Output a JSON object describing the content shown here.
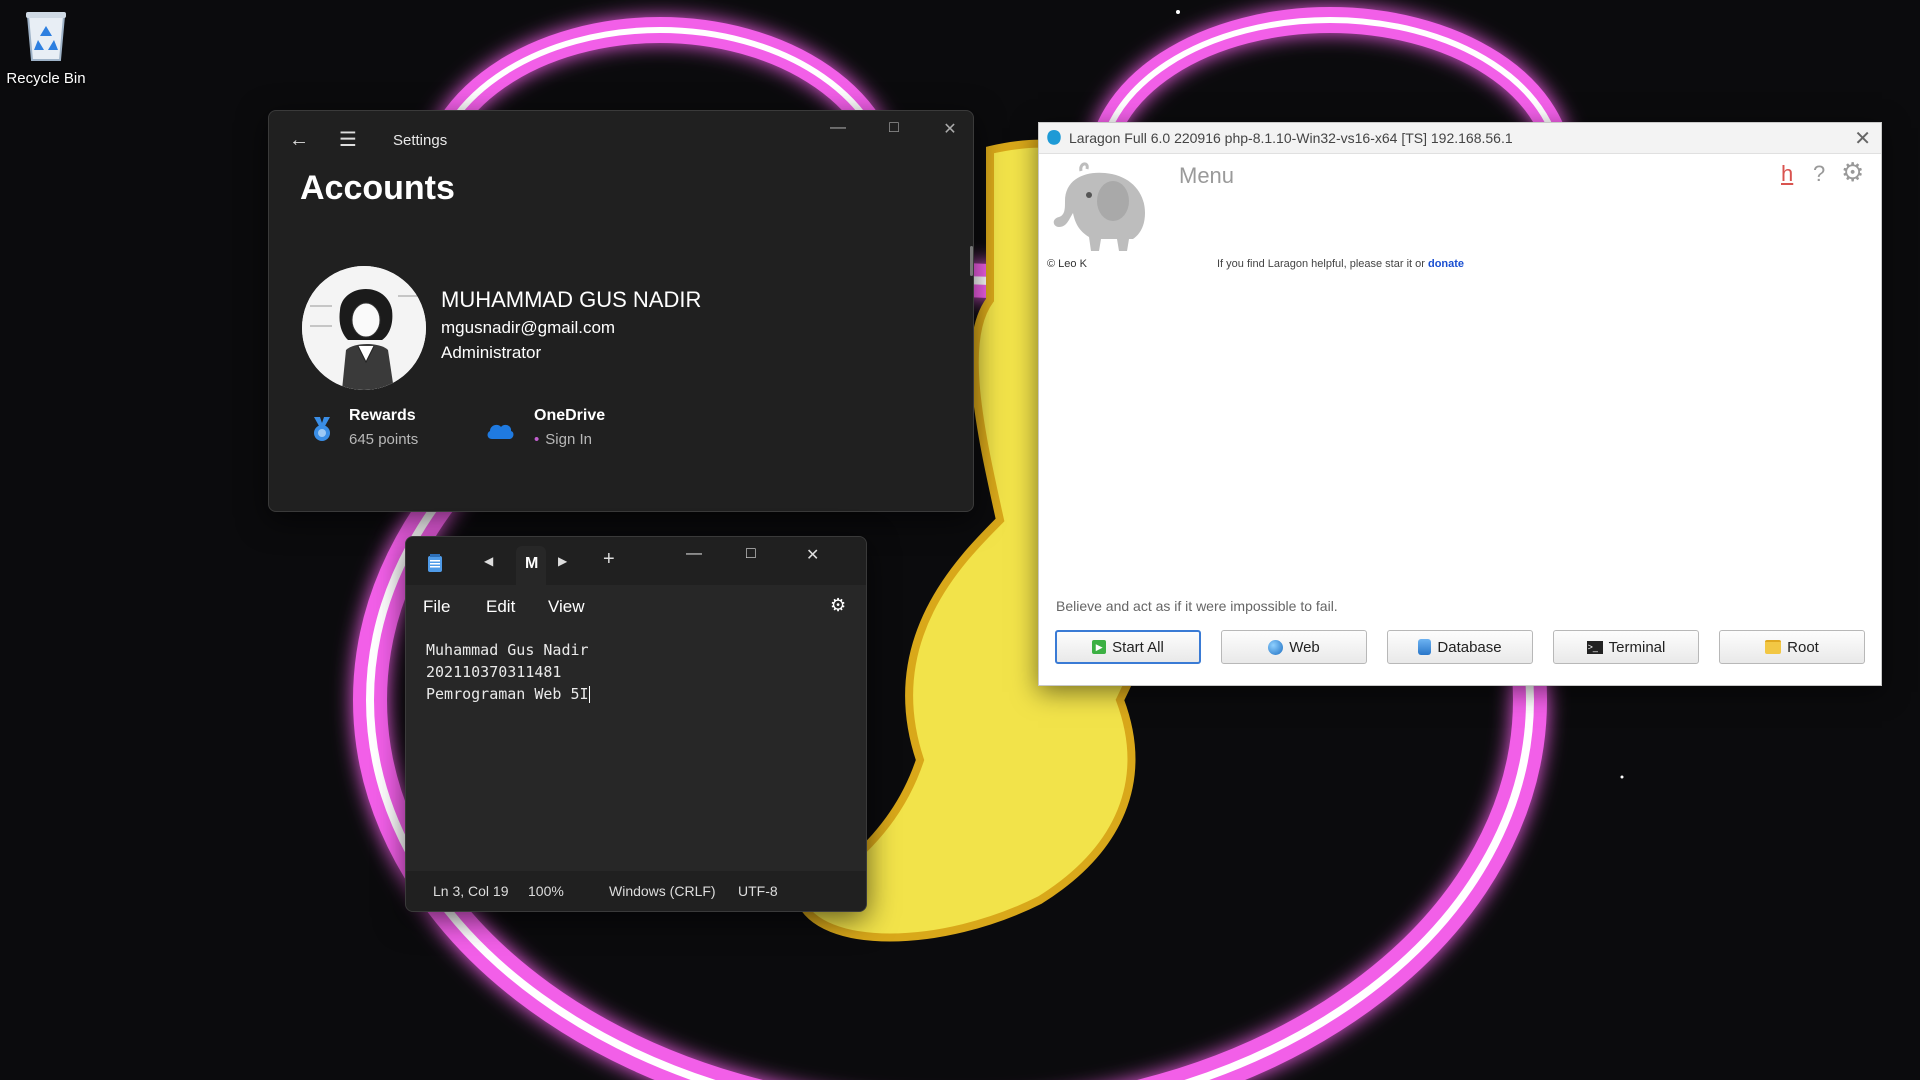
{
  "desktop": {
    "recycle_bin_label": "Recycle Bin"
  },
  "settings": {
    "app_title": "Settings",
    "page_title": "Accounts",
    "user_name": "MUHAMMAD GUS NADIR",
    "user_email": "mgusnadir@gmail.com",
    "user_role": "Administrator",
    "rewards_title": "Rewards",
    "rewards_points": "645 points",
    "onedrive_title": "OneDrive",
    "onedrive_status": "Sign In"
  },
  "notepad": {
    "tab_label": "M",
    "menu": {
      "file": "File",
      "edit": "Edit",
      "view": "View"
    },
    "lines": [
      "Muhammad Gus Nadir",
      "202110370311481",
      "Pemrograman Web 5I"
    ],
    "status": {
      "position": "Ln 3, Col 19",
      "zoom": "100%",
      "line_ending": "Windows (CRLF)",
      "encoding": "UTF-8"
    }
  },
  "laragon": {
    "title": "Laragon Full 6.0 220916 php-8.1.10-Win32-vs16-x64 [TS]  192.168.56.1",
    "menu_label": "Menu",
    "h_label": "h",
    "help_icon": "?",
    "copyright": "© Leo K",
    "help_text": "If you find Laragon helpful, please star it or",
    "donate_link": "donate",
    "quote": "Believe and act as if it were impossible to fail.",
    "buttons": {
      "start_all": "Start All",
      "web": "Web",
      "database": "Database",
      "terminal": "Terminal",
      "root": "Root"
    }
  },
  "colors": {
    "neon_pink": "#f25ee8",
    "cat_yellow": "#f2e34a",
    "laragon_accent": "#3a7bd5",
    "donate_link": "#1a4fd1"
  }
}
